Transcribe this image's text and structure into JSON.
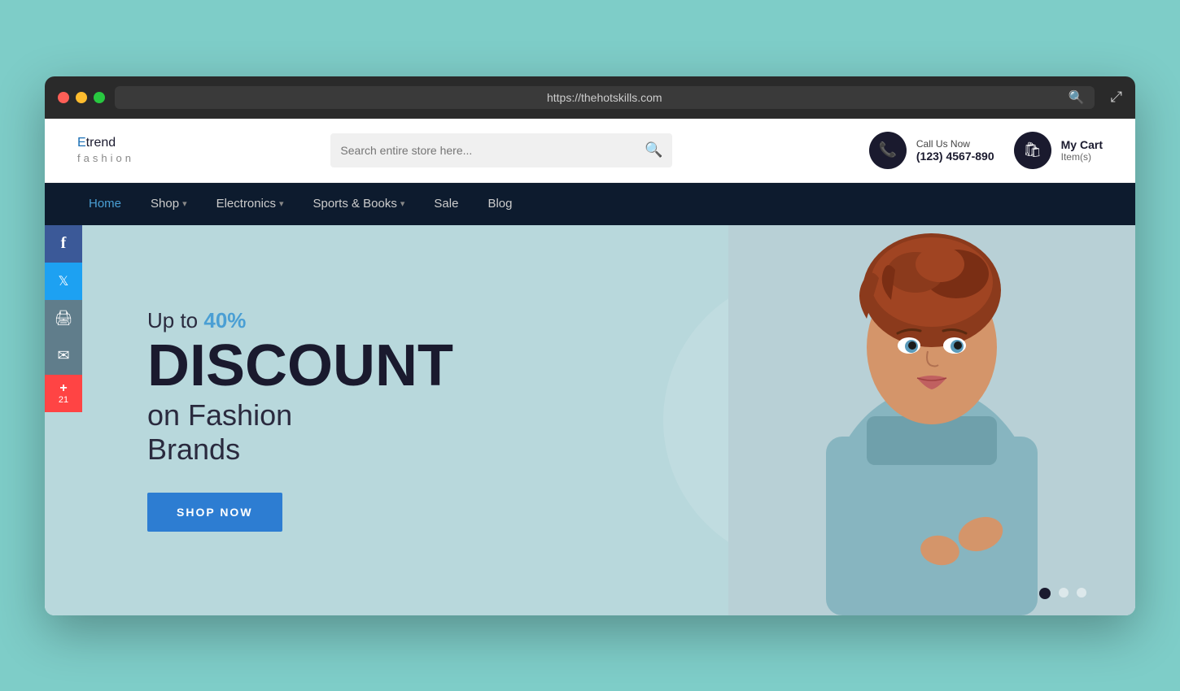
{
  "browser": {
    "url": "https://thehotskills.com",
    "dots": [
      "red",
      "yellow",
      "green"
    ]
  },
  "header": {
    "logo": {
      "first_letter": "E",
      "rest": "trend",
      "sub": "fashion"
    },
    "search": {
      "placeholder": "Search entire store here..."
    },
    "phone": {
      "label": "Call Us Now",
      "number": "(123) 4567-890"
    },
    "cart": {
      "label": "My Cart",
      "sub": "Item(s)"
    }
  },
  "nav": {
    "items": [
      {
        "label": "Home",
        "active": true,
        "hasDropdown": false
      },
      {
        "label": "Shop",
        "active": false,
        "hasDropdown": true
      },
      {
        "label": "Electronics",
        "active": false,
        "hasDropdown": true
      },
      {
        "label": "Sports & Books",
        "active": false,
        "hasDropdown": true
      },
      {
        "label": "Sale",
        "active": false,
        "hasDropdown": false
      },
      {
        "label": "Blog",
        "active": false,
        "hasDropdown": false
      }
    ]
  },
  "social": {
    "items": [
      {
        "name": "facebook",
        "icon": "f",
        "class": "facebook"
      },
      {
        "name": "twitter",
        "icon": "t",
        "class": "twitter"
      },
      {
        "name": "print",
        "icon": "p",
        "class": "print"
      },
      {
        "name": "email",
        "icon": "e",
        "class": "email"
      },
      {
        "name": "plus",
        "icon": "+",
        "count": "21",
        "class": "plus"
      }
    ]
  },
  "hero": {
    "pretext": "Up to",
    "discount_percent": "40%",
    "title": "DISCOUNT",
    "subtitle_line1": "on Fashion",
    "subtitle_line2": "Brands",
    "cta_label": "SHOP NOW",
    "carousel_slides": 3,
    "active_slide": 0
  }
}
